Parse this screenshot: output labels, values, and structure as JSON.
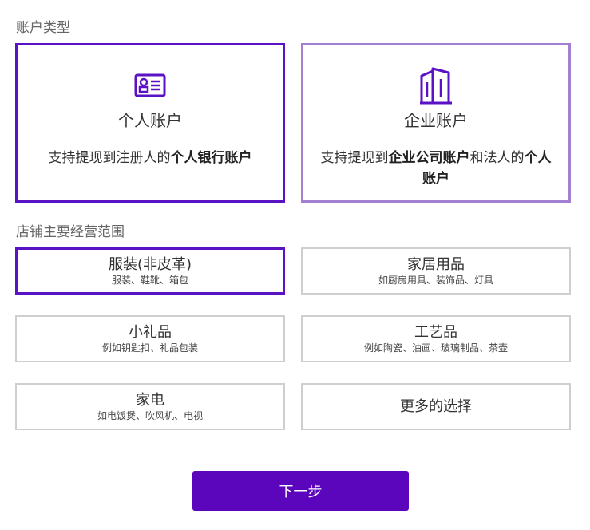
{
  "account_section": {
    "title": "账户类型",
    "personal": {
      "name": "个人账户",
      "desc_prefix": "支持提现到注册人的",
      "desc_bold": "个人银行账户",
      "icon": "id-card-icon"
    },
    "enterprise": {
      "name": "企业账户",
      "desc_prefix": "支持提现到",
      "desc_bold1": "企业公司账户",
      "desc_mid": "和法人的",
      "desc_bold2": "个人账户",
      "icon": "building-icon"
    }
  },
  "category_section": {
    "title": "店铺主要经营范围",
    "items": [
      {
        "name": "服装(非皮革)",
        "sub": "服装、鞋靴、箱包",
        "selected": true
      },
      {
        "name": "家居用品",
        "sub": "如厨房用具、装饰品、灯具",
        "selected": false
      },
      {
        "name": "小礼品",
        "sub": "例如钥匙扣、礼品包装",
        "selected": false
      },
      {
        "name": "工艺品",
        "sub": "例如陶瓷、油画、玻璃制品、茶壶",
        "selected": false
      },
      {
        "name": "家电",
        "sub": "如电饭煲、吹风机、电视",
        "selected": false
      },
      {
        "name": "更多的选择",
        "sub": "",
        "selected": false
      }
    ]
  },
  "footer": {
    "next_label": "下一步"
  },
  "colors": {
    "accent": "#5b06bd",
    "selected_border": "#5b11c4",
    "unselected_account_border": "#a27fd1",
    "category_border": "#cfcfcf"
  }
}
